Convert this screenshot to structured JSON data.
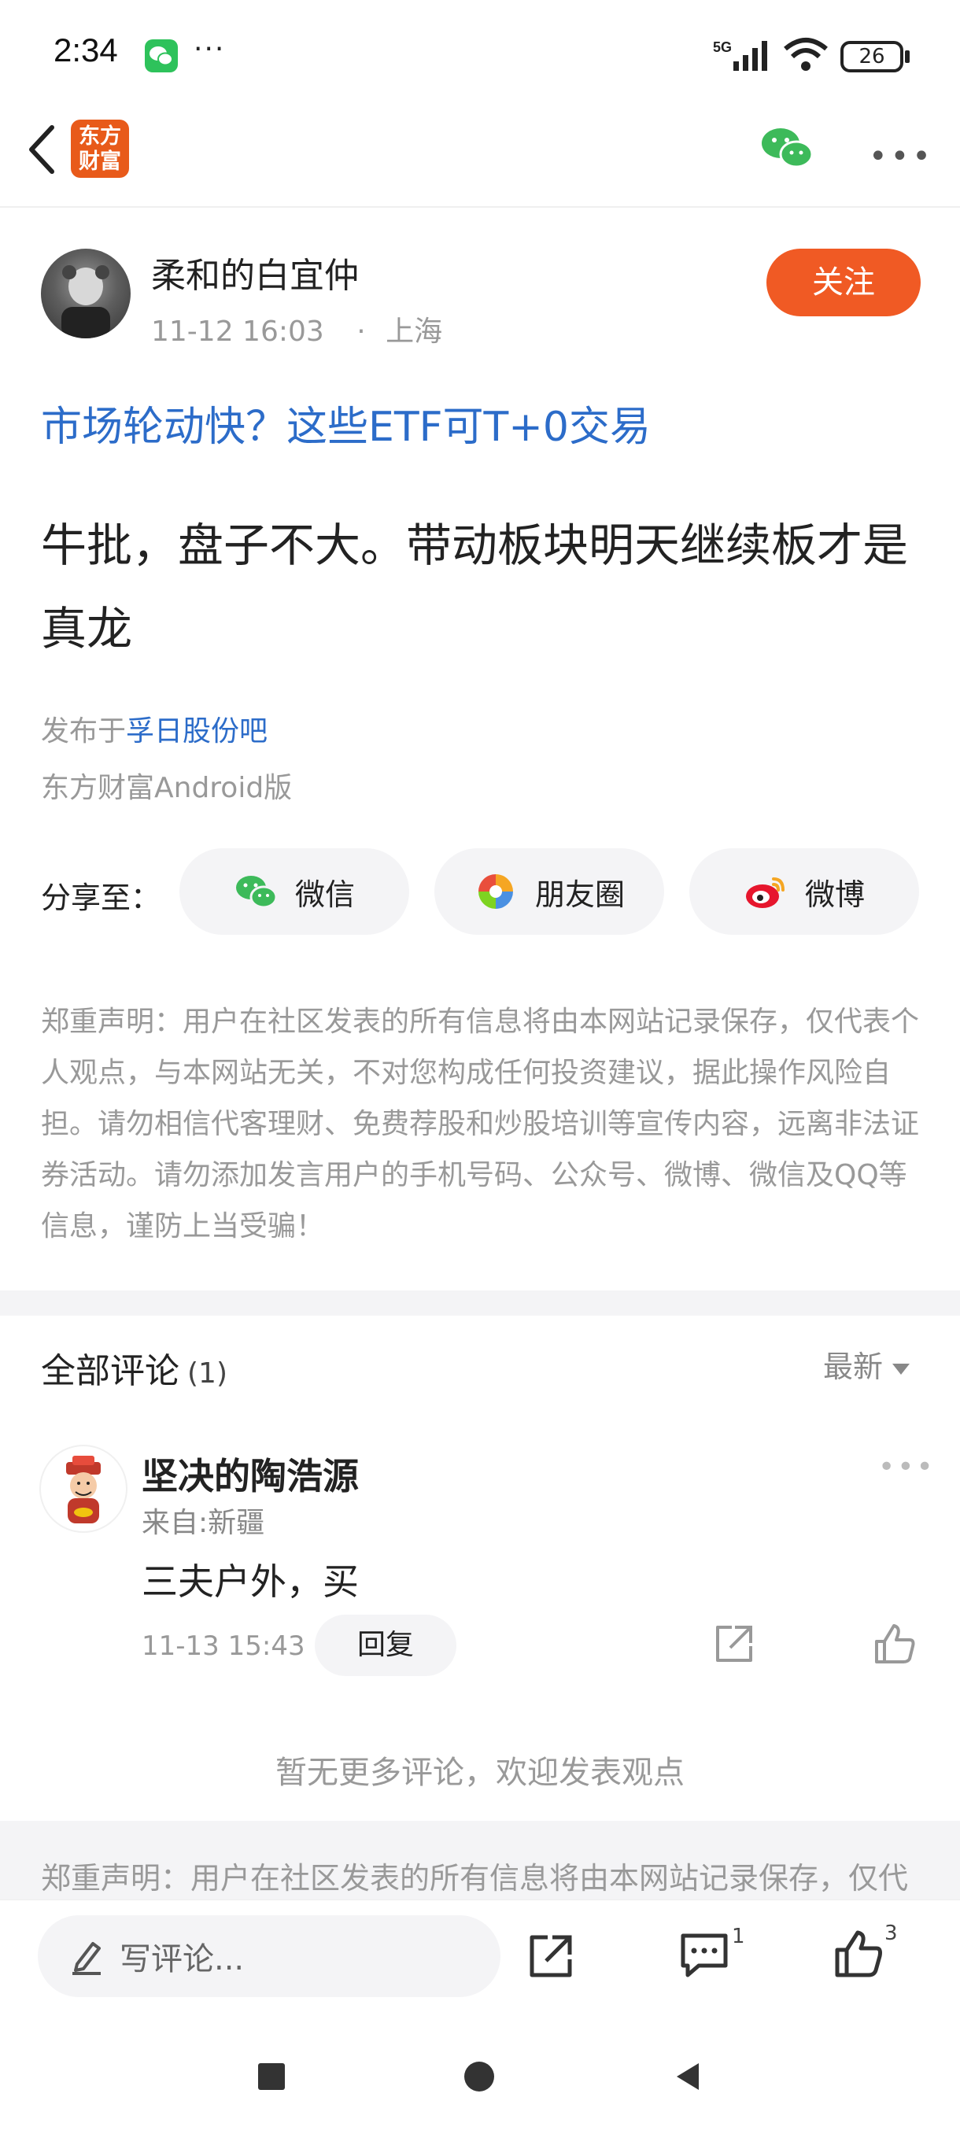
{
  "status_bar": {
    "time": "2:34",
    "dots": "···",
    "network": "5G",
    "battery": "26"
  },
  "nav": {
    "app_logo_text": "东方财富"
  },
  "post": {
    "author": "柔和的白宜仲",
    "time": "11-12 16:03",
    "location": "上海",
    "follow_label": "关注",
    "title": "市场轮动快？这些ETF可T+0交易",
    "body": "牛批，盘子不大。带动板块明天继续板才是真龙",
    "publish_prefix": "发布于",
    "forum": "孚日股份吧",
    "client": "东方财富Android版"
  },
  "share": {
    "label": "分享至：",
    "options": [
      "微信",
      "朋友圈",
      "微博"
    ]
  },
  "disclaimer": "郑重声明：用户在社区发表的所有信息将由本网站记录保存，仅代表个人观点，与本网站无关，不对您构成任何投资建议，据此操作风险自担。请勿相信代客理财、免费荐股和炒股培训等宣传内容，远离非法证券活动。请勿添加发言用户的手机号码、公众号、微博、微信及QQ等信息，谨防上当受骗！",
  "comments": {
    "title": "全部评论",
    "count": "(1)",
    "sort_label": "最新",
    "items": [
      {
        "name": "坚决的陶浩源",
        "location": "来自:新疆",
        "text": "三夫户外，买",
        "time": "11-13 15:43",
        "reply_label": "回复"
      }
    ],
    "no_more": "暂无更多评论，欢迎发表观点"
  },
  "bottom_disclaimer": "郑重声明：用户在社区发表的所有信息将由本网站记录保存，仅代",
  "bottom_bar": {
    "input_placeholder": "写评论...",
    "comment_count": "1",
    "like_count": "3"
  },
  "colors": {
    "accent_orange": "#f05a24",
    "link_blue": "#2c6cc9",
    "wechat_green": "#2ec25b"
  },
  "icons": [
    "wechat-icon",
    "back-icon",
    "more-icon",
    "moments-icon",
    "weibo-icon",
    "pen-icon",
    "share-icon",
    "comment-icon",
    "like-icon"
  ]
}
